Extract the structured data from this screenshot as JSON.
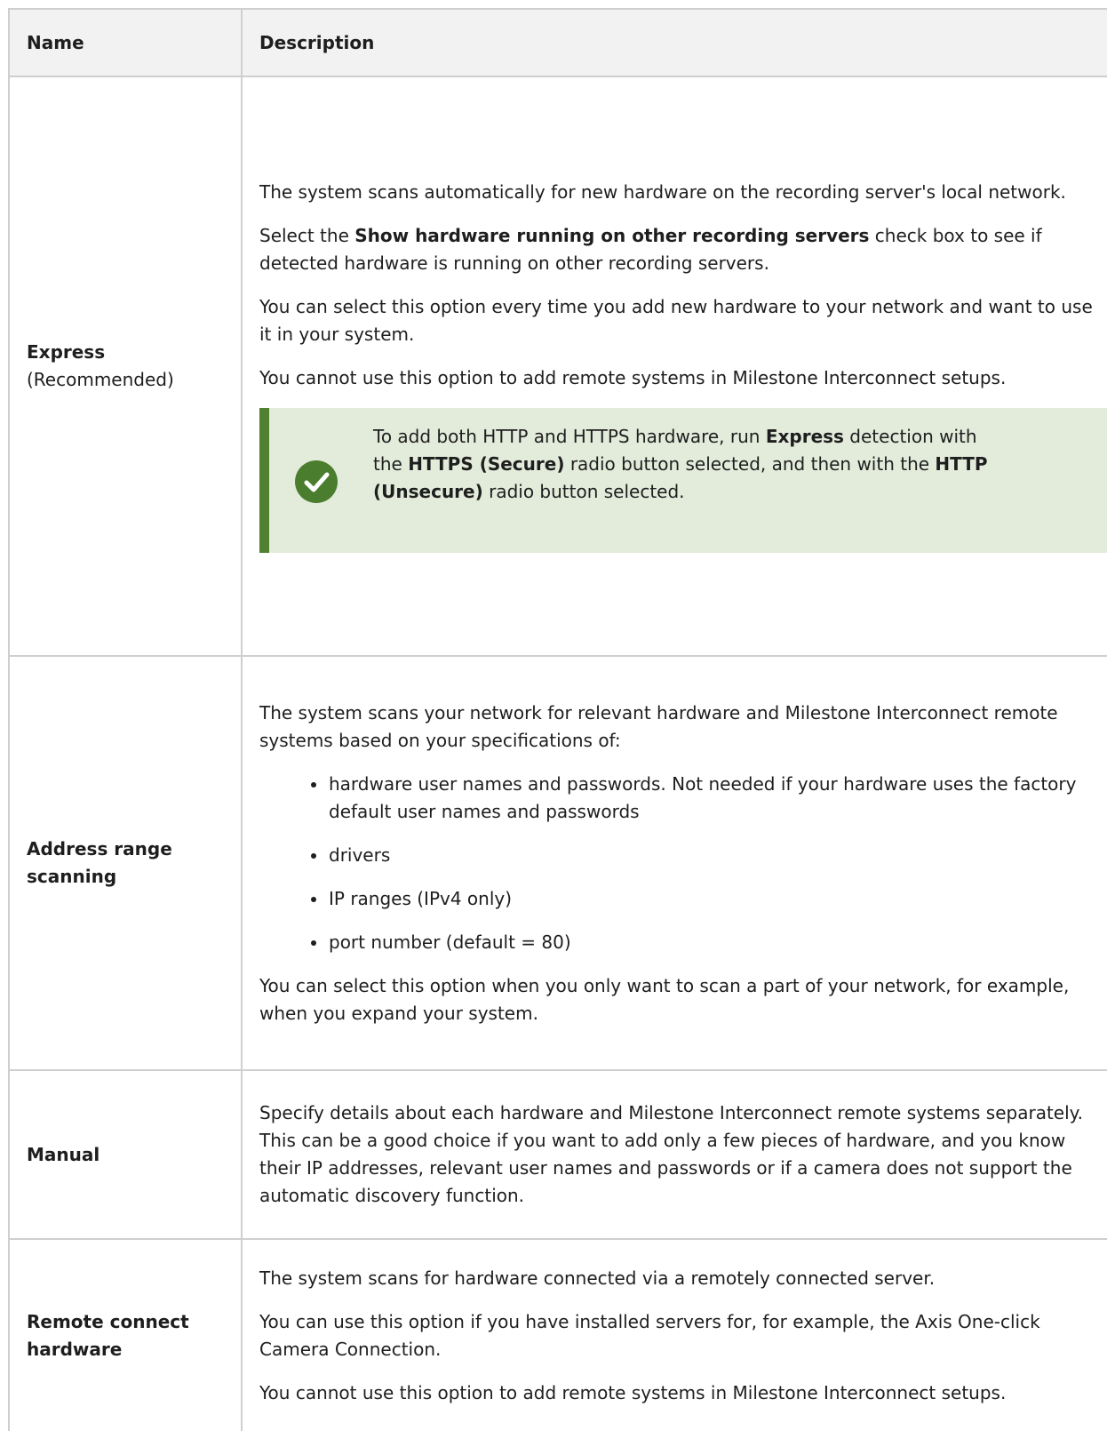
{
  "header": {
    "name": "Name",
    "description": "Description"
  },
  "rows": [
    {
      "name": "Express",
      "name_note": "(Recommended)",
      "p1": "The system scans automatically for new hardware on the recording server's local network.",
      "p2_pre": "Select the ",
      "p2_bold": "Show hardware running on other recording servers",
      "p2_post": " check box to see if detected hardware is running on other recording servers.",
      "p3": "You can select this option every time you add new hardware to your network and want to use it in your system.",
      "p4": "You cannot use this option to add remote systems in Milestone Interconnect setups.",
      "note": {
        "icon": "checkmark-icon",
        "t1": "To add both HTTP and HTTPS hardware, run ",
        "b1": "Express",
        "t2": " detection with the ",
        "b2": "HTTPS (Secure)",
        "t3": " radio button selected, and then with the ",
        "b3": "HTTP (Unsecure)",
        "t4": " radio button selected."
      }
    },
    {
      "name": "Address range scanning",
      "p1": "The system scans your network for relevant hardware and Milestone Interconnect remote systems based on your specifications of:",
      "bullets": [
        "hardware user names and passwords. Not needed if your hardware uses the factory default user names and passwords",
        "drivers",
        "IP ranges (IPv4 only)",
        "port number (default = 80)"
      ],
      "p2": "You can select this option when you only want to scan a part of your network, for example, when you expand your system."
    },
    {
      "name": "Manual",
      "p1": "Specify details about each hardware and Milestone Interconnect remote systems separately. This can be a good choice if you want to add only a few pieces of hardware, and you know their IP addresses, relevant user names and passwords or if a camera does not support the automatic discovery function."
    },
    {
      "name": "Remote connect hardware",
      "p1": "The system scans for hardware connected via a remotely connected server.",
      "p2": "You can use this option if you have installed servers for, for example, the Axis One-click Camera Connection.",
      "p3": "You cannot use this option to add remote systems in Milestone Interconnect setups."
    }
  ],
  "colors": {
    "note_background": "#e3ecdb",
    "note_border": "#4f8131",
    "icon": "#4a7d2e",
    "header_background": "#f2f2f2",
    "border": "#cfcfcf"
  }
}
